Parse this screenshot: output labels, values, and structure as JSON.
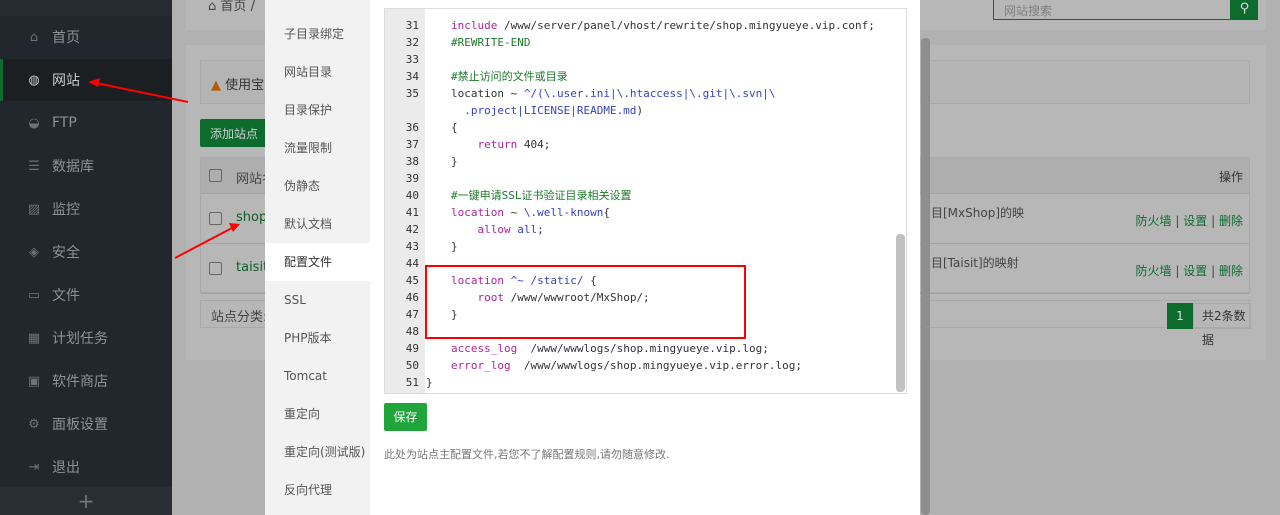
{
  "sidebar": {
    "items": [
      {
        "label": "首页",
        "icon": "home-icon",
        "glyph": "⌂"
      },
      {
        "label": "网站",
        "icon": "globe-icon",
        "glyph": "◍"
      },
      {
        "label": "FTP",
        "icon": "ftp-icon",
        "glyph": "◒"
      },
      {
        "label": "数据库",
        "icon": "database-icon",
        "glyph": "☰"
      },
      {
        "label": "监控",
        "icon": "monitor-icon",
        "glyph": "▨"
      },
      {
        "label": "安全",
        "icon": "shield-icon",
        "glyph": "◈"
      },
      {
        "label": "文件",
        "icon": "folder-icon",
        "glyph": "▭"
      },
      {
        "label": "计划任务",
        "icon": "calendar-icon",
        "glyph": "▦"
      },
      {
        "label": "软件商店",
        "icon": "apps-icon",
        "glyph": "▣"
      },
      {
        "label": "面板设置",
        "icon": "gear-icon",
        "glyph": "⚙"
      },
      {
        "label": "退出",
        "icon": "logout-icon",
        "glyph": "⇥"
      }
    ],
    "active": "网站",
    "add": "+"
  },
  "breadcrumb": {
    "home": "首页",
    "sep": "/"
  },
  "search": {
    "placeholder": "网站搜索"
  },
  "warning": {
    "text": "使用宝"
  },
  "add_site": "添加站点",
  "table": {
    "header_name": "网站名",
    "header_ops": "操作",
    "rows": [
      {
        "name": "shop.",
        "desc": "目[MxShop]的映",
        "ops": [
          "防火墙",
          "设置",
          "删除"
        ]
      },
      {
        "name": "taisit.",
        "desc": "目[Taisit]的映射",
        "ops": [
          "防火墙",
          "设置",
          "删除"
        ]
      }
    ]
  },
  "category_label": "站点分类:",
  "pagination": {
    "page": "1",
    "total": "共2条数据"
  },
  "modal": {
    "menu": [
      "子目录绑定",
      "网站目录",
      "目录保护",
      "流量限制",
      "伪静态",
      "默认文档",
      "配置文件",
      "SSL",
      "PHP版本",
      "Tomcat",
      "重定向",
      "重定向(测试版)",
      "反向代理"
    ],
    "active": "配置文件",
    "code": [
      {
        "n": "31",
        "t": [
          [
            "kw",
            "include"
          ],
          [
            "pl",
            " /www/server/panel/vhost/rewrite/shop.mingyueye.vip.conf;"
          ]
        ]
      },
      {
        "n": "32",
        "t": [
          [
            "cm",
            "#REWRITE-END"
          ]
        ]
      },
      {
        "n": "33",
        "t": []
      },
      {
        "n": "34",
        "t": [
          [
            "cm",
            "#禁止访问的文件或目录"
          ]
        ]
      },
      {
        "n": "35",
        "t": [
          [
            "pl",
            "location ~ "
          ],
          [
            "rx",
            "^/(\\.user.ini|\\.htaccess|\\.git|\\.svn|\\"
          ]
        ]
      },
      {
        "n": "",
        "t": [
          [
            "rx",
            "  .project|LICENSE|README.md"
          ],
          [
            "pl",
            ")"
          ]
        ]
      },
      {
        "n": "36",
        "t": [
          [
            "pl",
            "{"
          ]
        ]
      },
      {
        "n": "37",
        "t": [
          [
            "kw",
            "    return"
          ],
          [
            "pl",
            " 404;"
          ]
        ]
      },
      {
        "n": "38",
        "t": [
          [
            "pl",
            "}"
          ]
        ]
      },
      {
        "n": "39",
        "t": []
      },
      {
        "n": "40",
        "t": [
          [
            "cm",
            "#一键申请SSL证书验证目录相关设置"
          ]
        ]
      },
      {
        "n": "41",
        "t": [
          [
            "kw",
            "location"
          ],
          [
            "pl",
            " ~ "
          ],
          [
            "rx",
            "\\.well-known"
          ],
          [
            "pl",
            "{"
          ]
        ]
      },
      {
        "n": "42",
        "t": [
          [
            "kw",
            "    allow"
          ],
          [
            "rx",
            " all"
          ],
          [
            "pl",
            ";"
          ]
        ]
      },
      {
        "n": "43",
        "t": [
          [
            "pl",
            "}"
          ]
        ]
      },
      {
        "n": "44",
        "t": []
      },
      {
        "n": "45",
        "t": [
          [
            "kw",
            "location"
          ],
          [
            "rx",
            " ^~ /static/"
          ],
          [
            "pl",
            " {"
          ]
        ]
      },
      {
        "n": "46",
        "t": [
          [
            "kw",
            "    root"
          ],
          [
            "pl",
            " /www/wwwroot/MxShop/;"
          ]
        ]
      },
      {
        "n": "47",
        "t": [
          [
            "pl",
            "}"
          ]
        ]
      },
      {
        "n": "48",
        "t": []
      },
      {
        "n": "49",
        "t": [
          [
            "kw",
            "access_log"
          ],
          [
            "pl",
            "  /www/wwwlogs/shop.mingyueye.vip.log;"
          ]
        ]
      },
      {
        "n": "50",
        "t": [
          [
            "kw",
            "error_log"
          ],
          [
            "pl",
            "  /www/wwwlogs/shop.mingyueye.vip.error.log;"
          ]
        ]
      },
      {
        "n": "51",
        "t": [
          [
            "pl",
            "}"
          ]
        ]
      }
    ],
    "save": "保存",
    "note": "此处为站点主配置文件,若您不了解配置规则,请勿随意修改."
  },
  "colors": {
    "accent": "#20a53a",
    "highlight": "#ff0000"
  }
}
